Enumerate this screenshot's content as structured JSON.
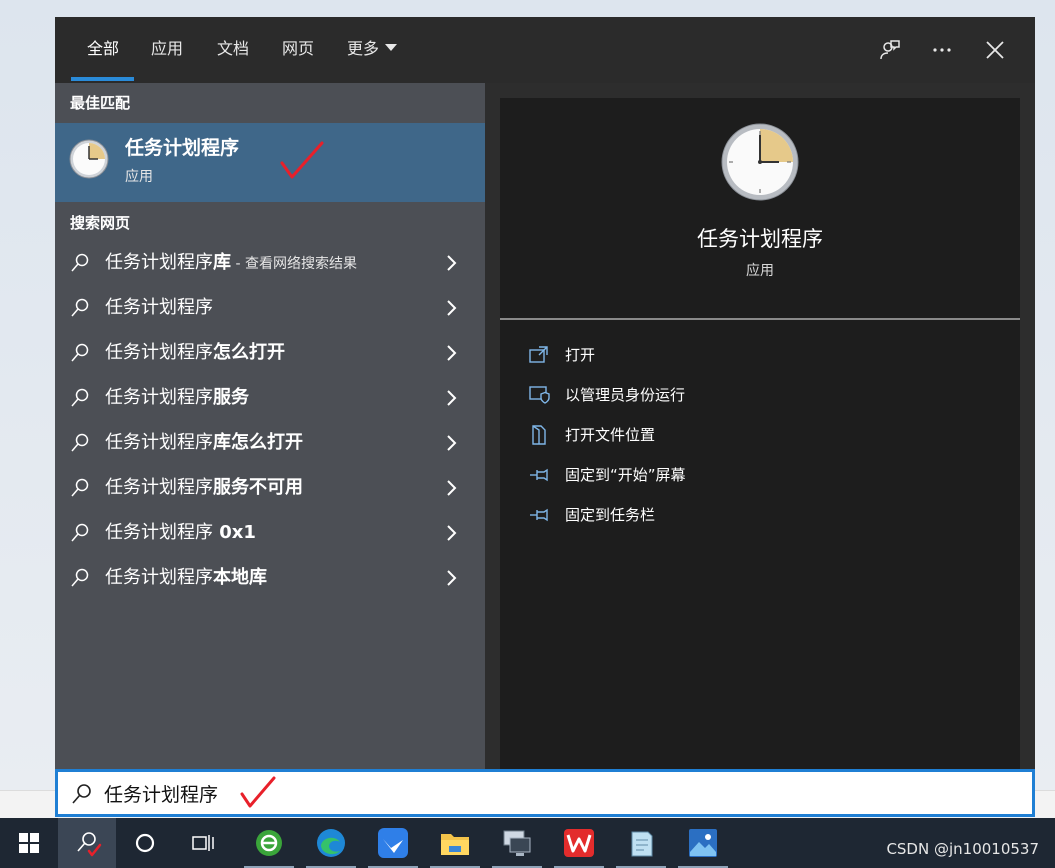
{
  "tabs": [
    {
      "label": "全部",
      "active": true
    },
    {
      "label": "应用"
    },
    {
      "label": "文档"
    },
    {
      "label": "网页"
    },
    {
      "label": "更多"
    }
  ],
  "header_icons": [
    "feedback-icon",
    "more-options-icon",
    "close-icon"
  ],
  "best_match": {
    "section_label": "最佳匹配",
    "title": "任务计划程序",
    "subtitle": "应用",
    "icon": "task-scheduler-clock-icon"
  },
  "web_search": {
    "section_label": "搜索网页",
    "results": [
      {
        "base": "任务计划程序",
        "bold": "库",
        "hint": " - 查看网络搜索结果"
      },
      {
        "base": "任务计划程序",
        "bold": "",
        "hint": ""
      },
      {
        "base": "任务计划程序",
        "bold": "怎么打开",
        "hint": ""
      },
      {
        "base": "任务计划程序",
        "bold": "服务",
        "hint": ""
      },
      {
        "base": "任务计划程序",
        "bold": "库怎么打开",
        "hint": ""
      },
      {
        "base": "任务计划程序",
        "bold": "服务不可用",
        "hint": ""
      },
      {
        "base": "任务计划程序",
        "bold": " 0x1",
        "hint": ""
      },
      {
        "base": "任务计划程序",
        "bold": "本地库",
        "hint": ""
      }
    ]
  },
  "detail": {
    "title": "任务计划程序",
    "subtitle": "应用",
    "icon": "task-scheduler-clock-icon",
    "actions": [
      {
        "label": "打开",
        "icon": "open-icon"
      },
      {
        "label": "以管理员身份运行",
        "icon": "admin-shield-icon"
      },
      {
        "label": "打开文件位置",
        "icon": "file-location-icon"
      },
      {
        "label": "固定到“开始”屏幕",
        "icon": "pin-icon"
      },
      {
        "label": "固定到任务栏",
        "icon": "pin-icon"
      }
    ]
  },
  "search": {
    "value": "任务计划程序"
  },
  "taskbar": {
    "items": [
      "start-icon",
      "search-icon",
      "cortana-icon",
      "task-view-icon",
      "green-browser-icon",
      "edge-icon",
      "feishu-icon",
      "file-explorer-icon",
      "remote-desktop-icon",
      "wps-icon",
      "notepad-icon",
      "photos-icon"
    ],
    "watermark": "CSDN @jn10010537"
  },
  "colors": {
    "accent": "#2a8bd9",
    "selected_row": "#3f6789",
    "left_pane": "#4c4f55",
    "right_pane": "#1d1d1d",
    "annotation_red": "#e8202a"
  }
}
